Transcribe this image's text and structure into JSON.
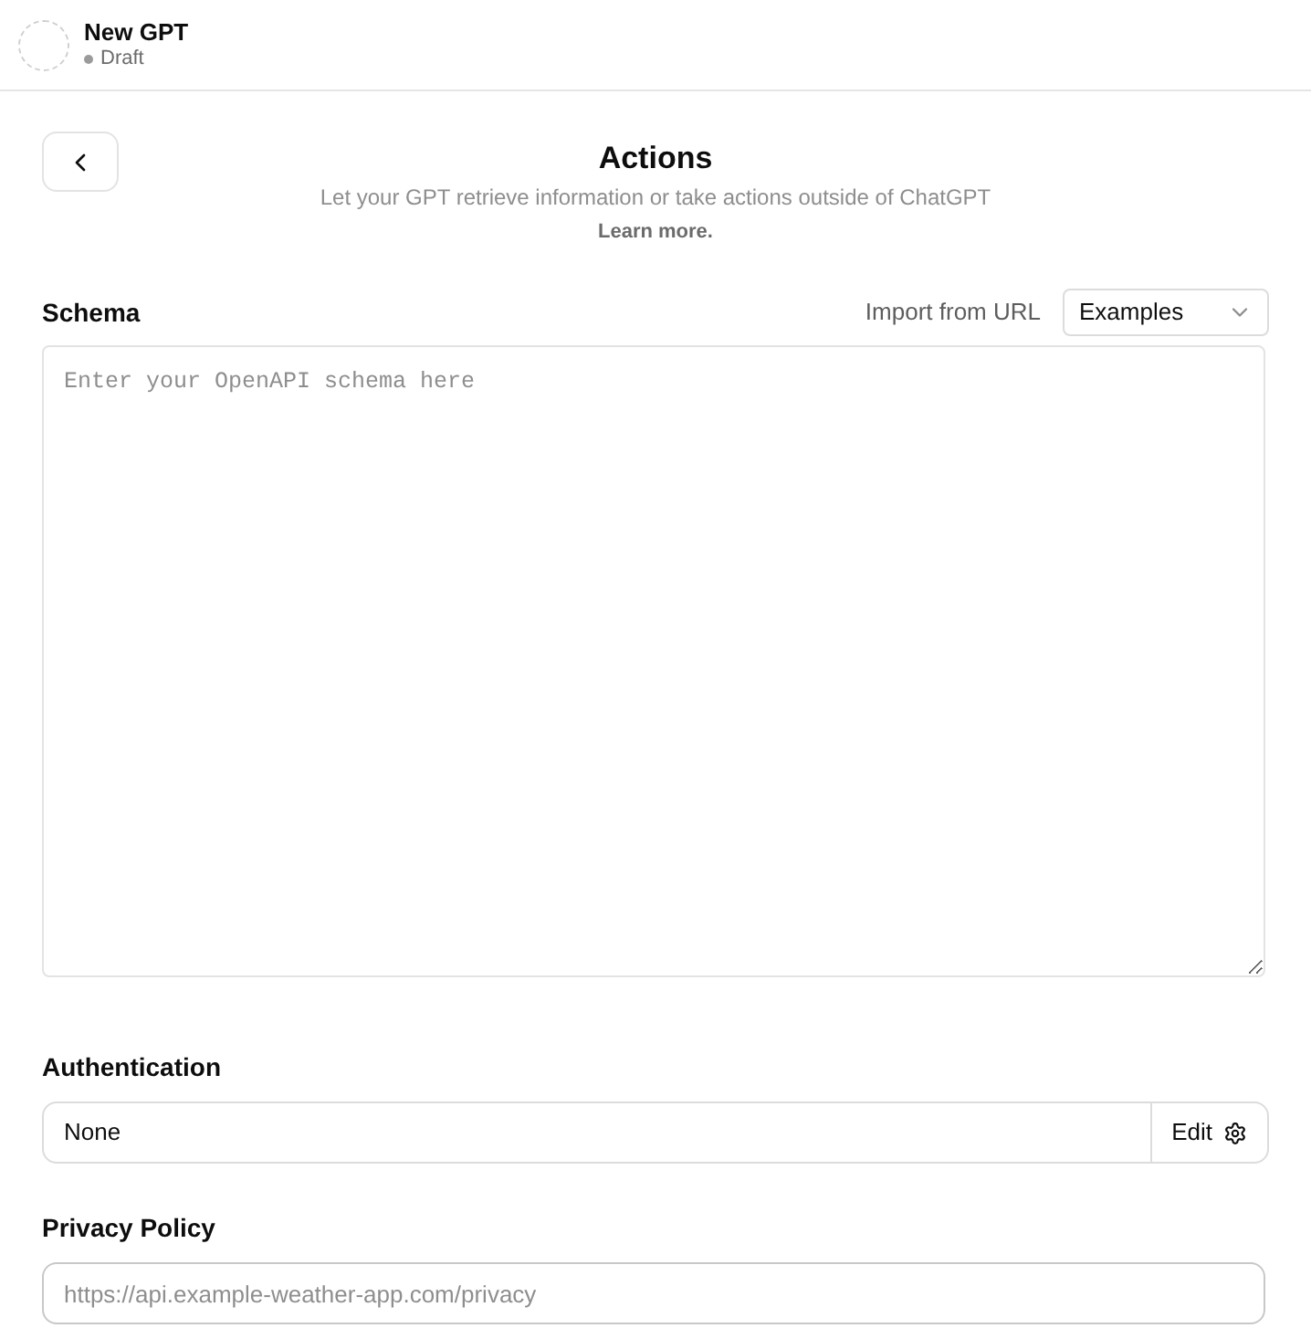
{
  "header": {
    "title": "New GPT",
    "status": "Draft"
  },
  "page": {
    "title": "Actions",
    "subtitle": "Let your GPT retrieve information or take actions outside of ChatGPT",
    "link": "Learn more."
  },
  "schema": {
    "label": "Schema",
    "import_link": "Import from URL",
    "examples_dropdown": "Examples",
    "placeholder": "Enter your OpenAPI schema here"
  },
  "authentication": {
    "label": "Authentication",
    "value": "None",
    "edit_button": "Edit"
  },
  "privacy_policy": {
    "label": "Privacy Policy",
    "placeholder": "https://api.example-weather-app.com/privacy"
  }
}
